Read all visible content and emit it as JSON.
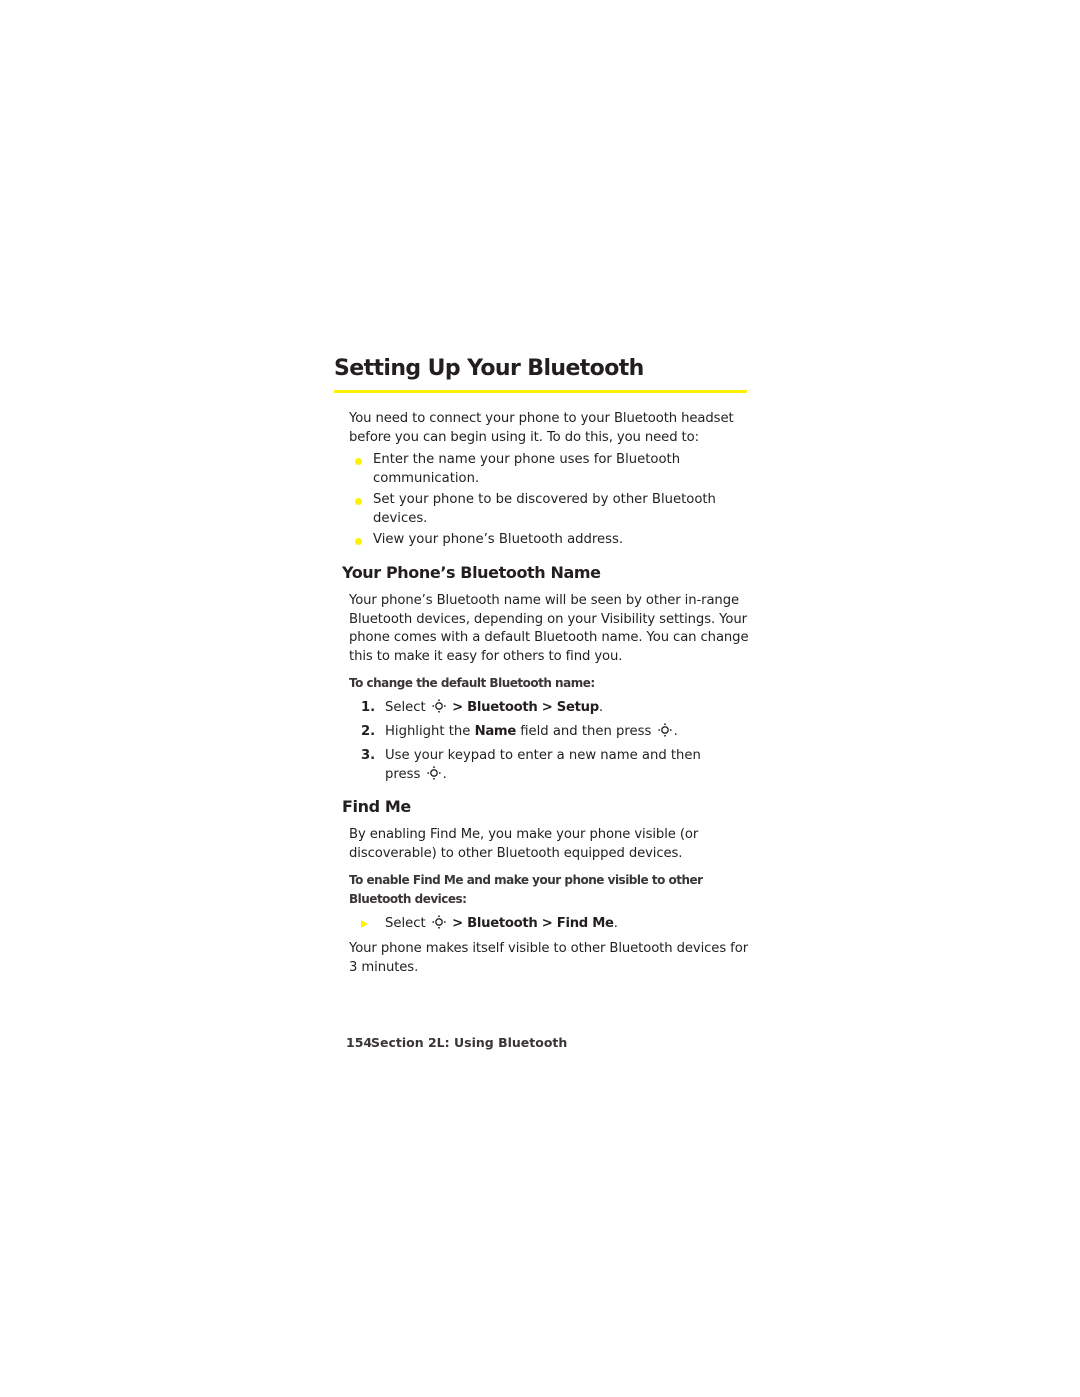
{
  "page": {
    "title": "Setting Up Your Bluetooth",
    "accent_color": "#fff200",
    "intro": "You need to connect your phone to your Bluetooth headset before you can begin using it. To do this, you need to:",
    "bullets": [
      "Enter the name your phone uses for Bluetooth communication.",
      "Set your phone to be discovered by other Bluetooth devices.",
      "View your phone’s Bluetooth address."
    ],
    "section1": {
      "heading": "Your Phone’s Bluetooth Name",
      "body": "Your phone’s Bluetooth name will be seen by other in-range Bluetooth devices, depending on your Visibility settings. Your phone comes with a default Bluetooth name. You can change this to make it easy for others to find you.",
      "procedure_title": "To change the default Bluetooth name:",
      "steps": [
        {
          "num": "1.",
          "pre": "Select",
          "icon": "nav-key-icon",
          "path": "> Bluetooth > Setup",
          "post": "."
        },
        {
          "num": "2.",
          "pre": "Highlight the",
          "bold": "Name",
          "mid": "field and then press",
          "icon": "nav-key-icon",
          "post": "."
        },
        {
          "num": "3.",
          "pre": "Use your keypad to enter a new name and then press",
          "icon": "nav-key-icon",
          "post": "."
        }
      ]
    },
    "section2": {
      "heading": "Find Me",
      "body": "By enabling Find Me, you make your phone visible (or discoverable) to other Bluetooth equipped devices.",
      "procedure_title": "To enable Find Me and make your phone visible to other Bluetooth devices:",
      "step": {
        "pre": "Select",
        "icon": "nav-key-icon",
        "path": "> Bluetooth > Find Me",
        "post": "."
      },
      "result": "Your phone makes itself visible to other Bluetooth devices for 3 minutes."
    },
    "footer": {
      "page_number": "154",
      "section_label": "Section 2L: Using Bluetooth"
    }
  }
}
